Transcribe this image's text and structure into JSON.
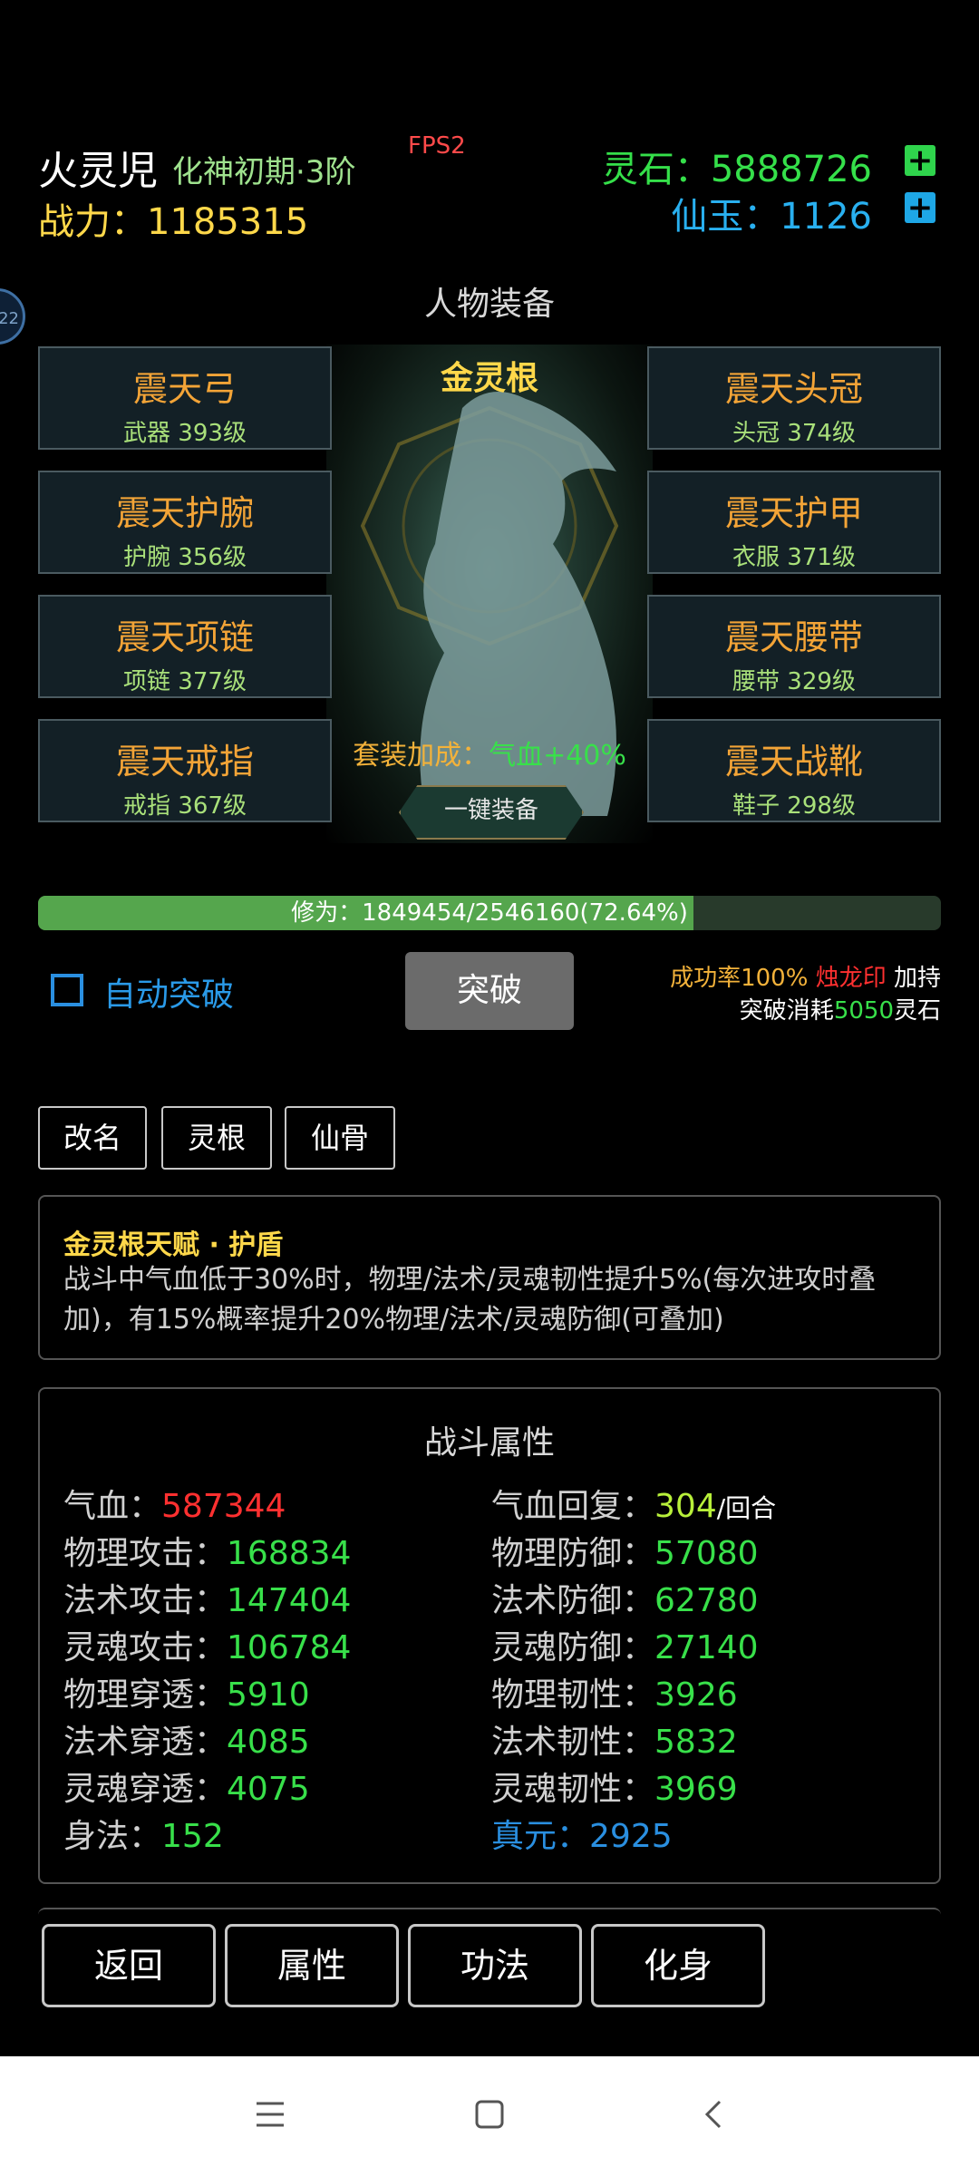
{
  "header": {
    "name": "火灵児",
    "realm": "化神初期·3阶",
    "fps": "FPS2",
    "power": "战力：1185315",
    "spirit_stone": "灵石：5888726",
    "immortal_jade": "仙玉：1126",
    "plus": "+",
    "side_bubble": "22"
  },
  "equipment": {
    "title": "人物装备",
    "root_label": "金灵根",
    "left": [
      {
        "name": "震天弓",
        "sub": "武器 393级"
      },
      {
        "name": "震天护腕",
        "sub": "护腕 356级"
      },
      {
        "name": "震天项链",
        "sub": "项链 377级"
      },
      {
        "name": "震天戒指",
        "sub": "戒指 367级"
      }
    ],
    "right": [
      {
        "name": "震天头冠",
        "sub": "头冠 374级"
      },
      {
        "name": "震天护甲",
        "sub": "衣服 371级"
      },
      {
        "name": "震天腰带",
        "sub": "腰带 329级"
      },
      {
        "name": "震天战靴",
        "sub": "鞋子 298级"
      }
    ],
    "set_bonus_label": "套装加成：",
    "set_bonus_value": "气血+40%",
    "one_key_equip": "一键装备"
  },
  "cultivation": {
    "text": "修为：1849454/2546160(72.64%)",
    "progress": 0.7264
  },
  "breakthrough": {
    "auto_label": "自动突破",
    "auto_checked": false,
    "button": "突破",
    "rate": "成功率100%",
    "seal": "烛龙印",
    "support": "加持",
    "cost_prefix": "突破消耗",
    "cost_value": "5050",
    "cost_suffix": "灵石"
  },
  "actions": {
    "rename": "改名",
    "root": "灵根",
    "bone": "仙骨"
  },
  "talent": {
    "title": "金灵根天赋 · 护盾",
    "desc": "战斗中气血低于30%时，物理/法术/灵魂韧性提升5%(每次进攻时叠加)，有15%概率提升20%物理/法术/灵魂防御(可叠加)"
  },
  "stats": {
    "title": "战斗属性",
    "left": [
      {
        "k": "气血：",
        "v": "587344"
      },
      {
        "k": "物理攻击：",
        "v": "168834"
      },
      {
        "k": "法术攻击：",
        "v": "147404"
      },
      {
        "k": "灵魂攻击：",
        "v": "106784"
      },
      {
        "k": "物理穿透：",
        "v": "5910"
      },
      {
        "k": "法术穿透：",
        "v": "4085"
      },
      {
        "k": "灵魂穿透：",
        "v": "4075"
      },
      {
        "k": "身法：",
        "v": "152"
      }
    ],
    "right": [
      {
        "k": "气血回复：",
        "v": "304",
        "u": "/回合"
      },
      {
        "k": "物理防御：",
        "v": "57080"
      },
      {
        "k": "法术防御：",
        "v": "62780"
      },
      {
        "k": "灵魂防御：",
        "v": "27140"
      },
      {
        "k": "物理韧性：",
        "v": "3926"
      },
      {
        "k": "法术韧性：",
        "v": "5832"
      },
      {
        "k": "灵魂韧性：",
        "v": "3969"
      },
      {
        "k": "真元：",
        "v": "2925"
      }
    ]
  },
  "nav": {
    "back": "返回",
    "attributes": "属性",
    "skills": "功法",
    "avatar": "化身"
  },
  "colors": {
    "gold": "#ffd84a",
    "green": "#38e04a",
    "blue": "#2a8fe0",
    "orange": "#f3a437",
    "red": "#ff3030"
  }
}
